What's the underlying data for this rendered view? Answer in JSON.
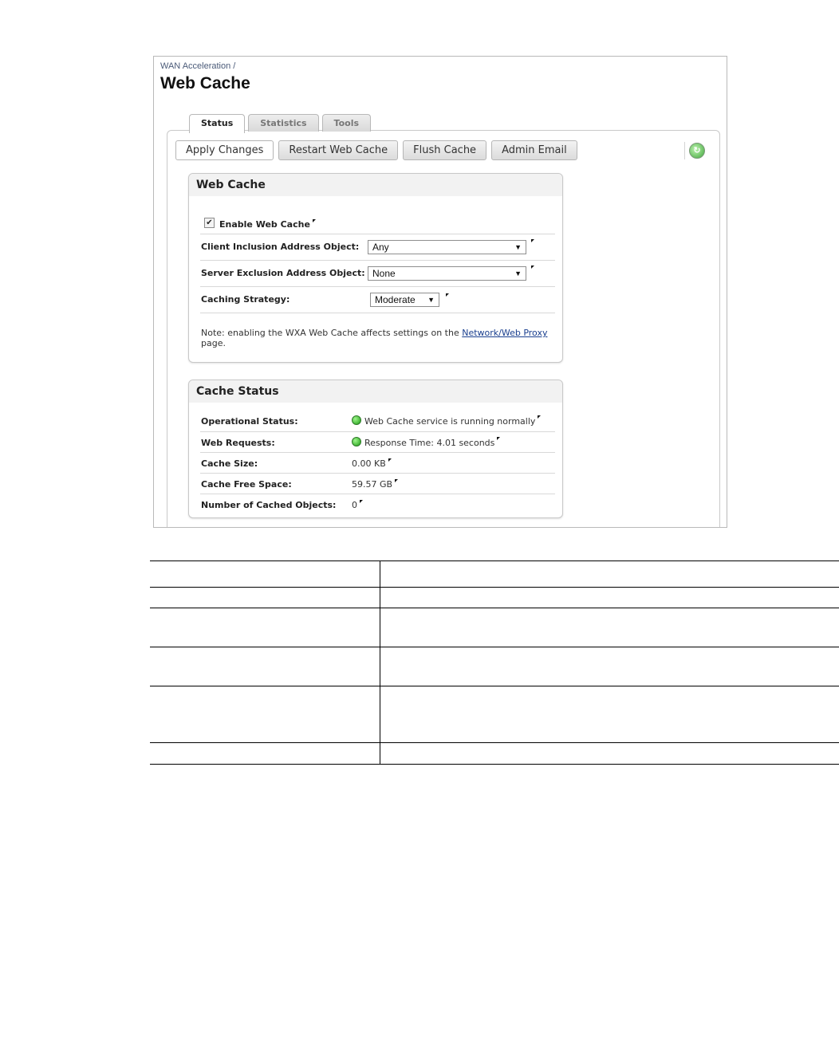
{
  "breadcrumb": "WAN Acceleration /",
  "title": "Web Cache",
  "tabs": [
    {
      "label": "Status",
      "active": true
    },
    {
      "label": "Statistics",
      "active": false
    },
    {
      "label": "Tools",
      "active": false
    }
  ],
  "toolbar": {
    "apply": "Apply Changes",
    "restart": "Restart Web Cache",
    "flush": "Flush Cache",
    "admin_email": "Admin Email",
    "refresh_icon": "refresh-icon"
  },
  "web_cache": {
    "heading": "Web Cache",
    "enable_label": "Enable Web Cache",
    "enable_checked": true,
    "client_label": "Client Inclusion Address Object:",
    "client_value": "Any",
    "server_label": "Server Exclusion Address Object:",
    "server_value": "None",
    "strategy_label": "Caching Strategy:",
    "strategy_value": "Moderate",
    "note_pre": "Note: enabling the WXA Web Cache affects settings on the ",
    "note_link": "Network/Web Proxy",
    "note_post": " page."
  },
  "cache_status": {
    "heading": "Cache Status",
    "operational_label": "Operational Status:",
    "operational_value": "Web Cache service is running normally",
    "requests_label": "Web Requests:",
    "requests_value": "Response Time: 4.01 seconds",
    "size_label": "Cache Size:",
    "size_value": "0.00 KB",
    "free_label": "Cache Free Space:",
    "free_value": "59.57 GB",
    "objects_label": "Number of Cached Objects:",
    "objects_value": "0"
  },
  "colors": {
    "status_ok": "#1c9b12",
    "link": "#1a3f8f"
  }
}
